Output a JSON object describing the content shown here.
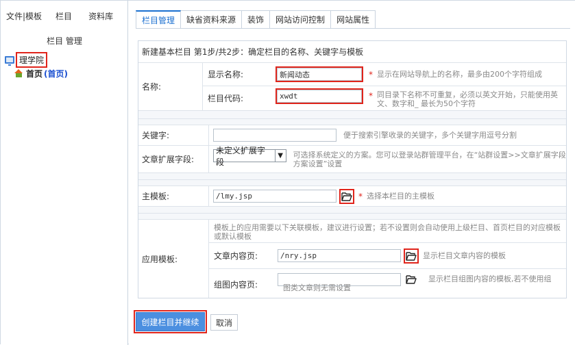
{
  "left_panel": {
    "tabs": [
      "文件|模板",
      "栏目",
      "资料库"
    ],
    "title": "栏目 管理",
    "tree": {
      "root_label": "理学院",
      "home_label": "首页",
      "home_tag": "(首页)"
    }
  },
  "tabs": [
    "栏目管理",
    "缺省资料来源",
    "装饰",
    "网站访问控制",
    "网站属性"
  ],
  "form": {
    "heading": "新建基本栏目 第1步/共2步：确定栏目的名称、关键字与模板",
    "name": {
      "label": "名称:",
      "display_name_label": "显示名称:",
      "display_name_value": "新闻动态",
      "display_name_hint": "显示在网站导航上的名称，最多由200个字符组成",
      "code_label": "栏目代码:",
      "code_value": "xwdt",
      "code_hint": "同目录下名称不可重复，必须以英文开始，只能使用英文、数字和_ 最长为50个字符"
    },
    "keywords": {
      "label": "关键字:",
      "value": "",
      "hint": "便于搜索引擎收录的关键字，多个关键字用逗号分割"
    },
    "ext_fields": {
      "label": "文章扩展字段:",
      "selected": "未定义扩展字段",
      "hint": "可选择系统定义的方案。您可以登录站群管理平台，在“站群设置>>文章扩展字段方案设置”设置"
    },
    "main_template": {
      "label": "主模板:",
      "value": "/lmy.jsp",
      "hint": "选择本栏目的主模板"
    },
    "app_templates": {
      "label": "应用模板:",
      "intro": "模板上的应用需要以下关联模板，建议进行设置；若不设置则会自动使用上级栏目、首页栏目的对应模板或默认模板",
      "article_label": "文章内容页:",
      "article_value": "/nry.jsp",
      "article_hint": "显示栏目文章内容的模板",
      "gallery_label": "组图内容页:",
      "gallery_value": "",
      "gallery_hint": "显示栏目组图内容的模板,若不使用组图类文章则无需设置"
    },
    "star": "*"
  },
  "buttons": {
    "create": "创建栏目并继续",
    "cancel": "取消"
  },
  "colors": {
    "accent": "#1a6fd0",
    "highlight": "#e0241b",
    "primary_button": "#4b8fe0"
  }
}
